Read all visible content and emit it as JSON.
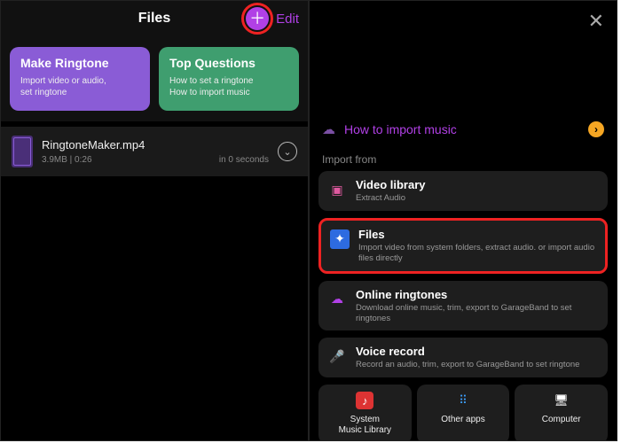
{
  "left": {
    "title": "Files",
    "edit": "Edit",
    "cards": {
      "make": {
        "title": "Make Ringtone",
        "sub": "Import video or audio,\nset ringtone"
      },
      "faq": {
        "title": "Top Questions",
        "sub": "How to set a ringtone\nHow to import music"
      }
    },
    "file": {
      "name": "RingtoneMaker.mp4",
      "meta": "3.9MB | 0:26",
      "age": "in 0 seconds"
    }
  },
  "right": {
    "howto": "How to import music",
    "section": "Import from",
    "opts": {
      "video": {
        "title": "Video library",
        "sub": "Extract Audio"
      },
      "files": {
        "title": "Files",
        "sub": "Import video from system folders, extract audio. or import audio files directly"
      },
      "online": {
        "title": "Online ringtones",
        "sub": "Download online music, trim, export to GarageBand to set ringtones"
      },
      "voice": {
        "title": "Voice record",
        "sub": "Record an audio, trim, export to GarageBand to set ringtone"
      }
    },
    "bottom": {
      "sys": "System\nMusic Library",
      "apps": "Other apps",
      "comp": "Computer"
    }
  }
}
